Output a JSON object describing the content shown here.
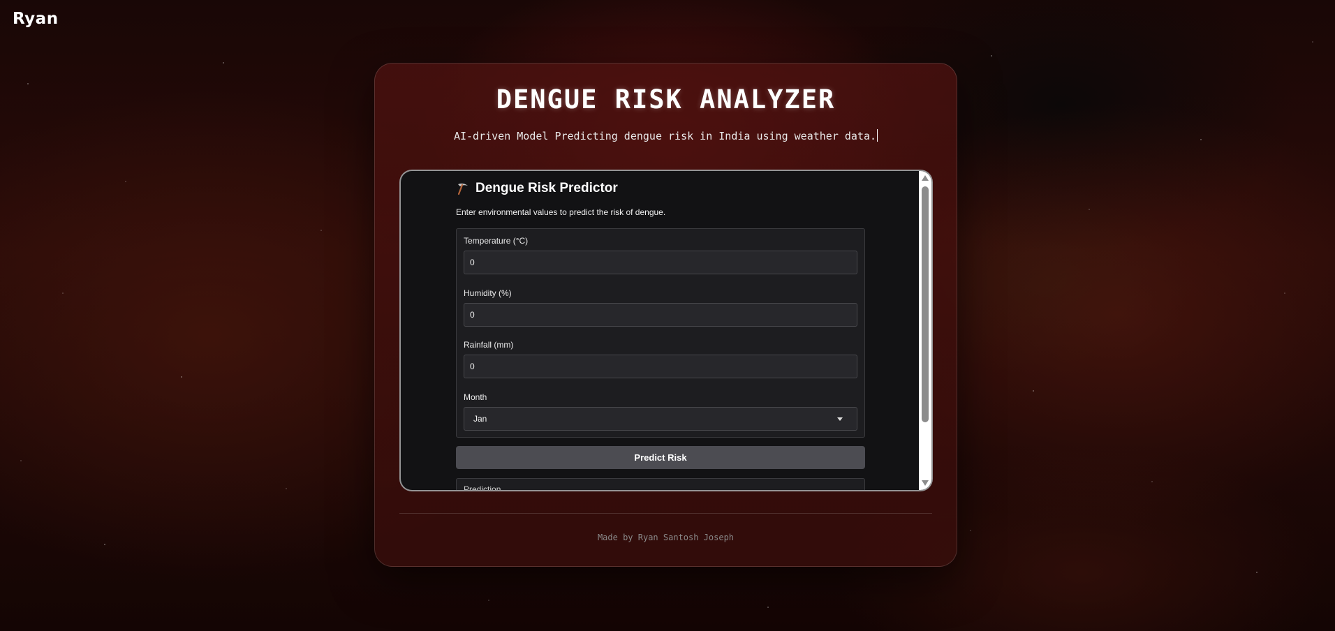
{
  "brand": {
    "name": "Ryan"
  },
  "card": {
    "title": "DENGUE RISK ANALYZER",
    "subtitle": "AI-driven Model Predicting dengue risk in India using weather data."
  },
  "app": {
    "title": "Dengue Risk Predictor",
    "title_icon": "pickaxe-icon",
    "description": "Enter environmental values to predict the risk of dengue.",
    "fields": {
      "temperature": {
        "label": "Temperature (°C)",
        "value": "0"
      },
      "humidity": {
        "label": "Humidity (%)",
        "value": "0"
      },
      "rainfall": {
        "label": "Rainfall (mm)",
        "value": "0"
      },
      "month": {
        "label": "Month",
        "value": "Jan"
      }
    },
    "predict_label": "Predict Risk",
    "output_label": "Prediction"
  },
  "footer": {
    "text": "Made by Ryan Santosh Joseph"
  },
  "colors": {
    "background": "#1e0806",
    "card": "#4e1210",
    "app_background": "#121214",
    "button": "#4c4c52"
  }
}
